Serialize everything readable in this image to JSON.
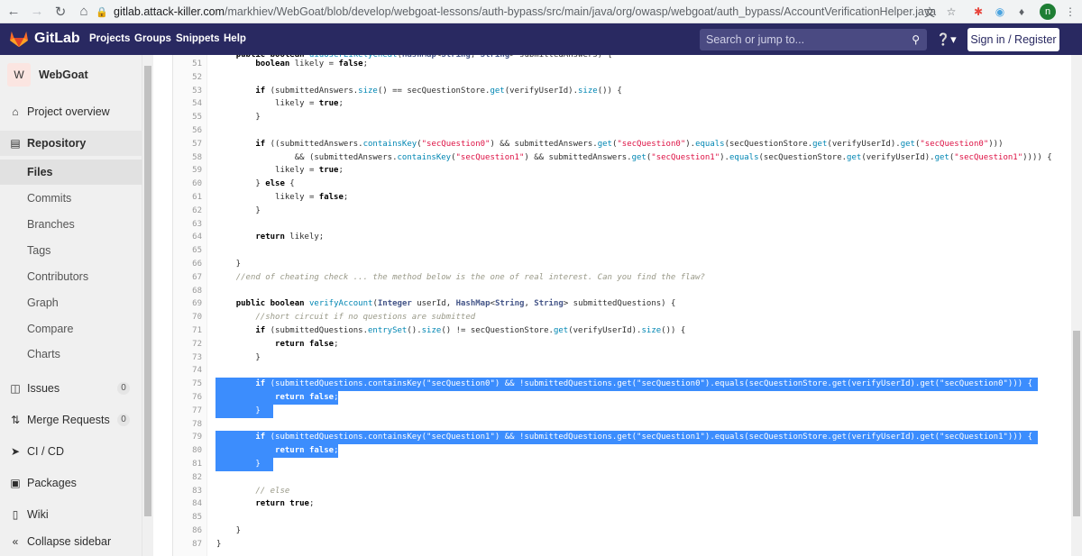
{
  "browser": {
    "url_host": "gitlab.attack-killer.com",
    "url_path": "/markhiev/WebGoat/blob/develop/webgoat-lessons/auth-bypass/src/main/java/org/owasp/webgoat/auth_bypass/AccountVerificationHelper.java",
    "profile_initial": "n"
  },
  "header": {
    "brand": "GitLab",
    "nav": [
      "Projects",
      "Groups",
      "Snippets",
      "Help"
    ],
    "search_placeholder": "Search or jump to...",
    "signin_label": "Sign in / Register"
  },
  "sidebar": {
    "project_initial": "W",
    "project_name": "WebGoat",
    "items": {
      "overview": "Project overview",
      "repository": "Repository",
      "files": "Files",
      "commits": "Commits",
      "branches": "Branches",
      "tags": "Tags",
      "contributors": "Contributors",
      "graph": "Graph",
      "compare": "Compare",
      "charts": "Charts",
      "issues": "Issues",
      "issues_count": "0",
      "merge_requests": "Merge Requests",
      "merge_requests_count": "0",
      "cicd": "CI / CD",
      "packages": "Packages",
      "wiki": "Wiki",
      "collapse": "Collapse sidebar"
    }
  },
  "code": {
    "partial_top": "    public boolean didUserLikelyCheat(HashMap<String, String> submittedAnswers) {",
    "lines": [
      {
        "n": "51",
        "t": "        boolean likely = false;"
      },
      {
        "n": "52",
        "t": ""
      },
      {
        "n": "53",
        "t": "        if (submittedAnswers.size() == secQuestionStore.get(verifyUserId).size()) {"
      },
      {
        "n": "54",
        "t": "            likely = true;"
      },
      {
        "n": "55",
        "t": "        }"
      },
      {
        "n": "56",
        "t": ""
      },
      {
        "n": "57",
        "t": "        if ((submittedAnswers.containsKey(\"secQuestion0\") && submittedAnswers.get(\"secQuestion0\").equals(secQuestionStore.get(verifyUserId).get(\"secQuestion0\")))"
      },
      {
        "n": "58",
        "t": "                && (submittedAnswers.containsKey(\"secQuestion1\") && submittedAnswers.get(\"secQuestion1\").equals(secQuestionStore.get(verifyUserId).get(\"secQuestion1\")))) {"
      },
      {
        "n": "59",
        "t": "            likely = true;"
      },
      {
        "n": "60",
        "t": "        } else {"
      },
      {
        "n": "61",
        "t": "            likely = false;"
      },
      {
        "n": "62",
        "t": "        }"
      },
      {
        "n": "63",
        "t": ""
      },
      {
        "n": "64",
        "t": "        return likely;"
      },
      {
        "n": "65",
        "t": ""
      },
      {
        "n": "66",
        "t": "    }"
      },
      {
        "n": "67",
        "t": "    //end of cheating check ... the method below is the one of real interest. Can you find the flaw?"
      },
      {
        "n": "68",
        "t": ""
      },
      {
        "n": "69",
        "t": "    public boolean verifyAccount(Integer userId, HashMap<String, String> submittedQuestions) {"
      },
      {
        "n": "70",
        "t": "        //short circuit if no questions are submitted"
      },
      {
        "n": "71",
        "t": "        if (submittedQuestions.entrySet().size() != secQuestionStore.get(verifyUserId).size()) {"
      },
      {
        "n": "72",
        "t": "            return false;"
      },
      {
        "n": "73",
        "t": "        }"
      },
      {
        "n": "74",
        "t": ""
      },
      {
        "n": "75",
        "t": "        if (submittedQuestions.containsKey(\"secQuestion0\") && !submittedQuestions.get(\"secQuestion0\").equals(secQuestionStore.get(verifyUserId).get(\"secQuestion0\"))) {"
      },
      {
        "n": "76",
        "t": "            return false;"
      },
      {
        "n": "77",
        "t": "        }"
      },
      {
        "n": "78",
        "t": ""
      },
      {
        "n": "79",
        "t": "        if (submittedQuestions.containsKey(\"secQuestion1\") && !submittedQuestions.get(\"secQuestion1\").equals(secQuestionStore.get(verifyUserId).get(\"secQuestion1\"))) {"
      },
      {
        "n": "80",
        "t": "            return false;"
      },
      {
        "n": "81",
        "t": "        }"
      },
      {
        "n": "82",
        "t": ""
      },
      {
        "n": "83",
        "t": "        // else"
      },
      {
        "n": "84",
        "t": "        return true;"
      },
      {
        "n": "85",
        "t": ""
      },
      {
        "n": "86",
        "t": "    }"
      },
      {
        "n": "87",
        "t": "}"
      }
    ],
    "selected_lines": [
      "75",
      "76",
      "77",
      "79",
      "80",
      "81"
    ]
  }
}
